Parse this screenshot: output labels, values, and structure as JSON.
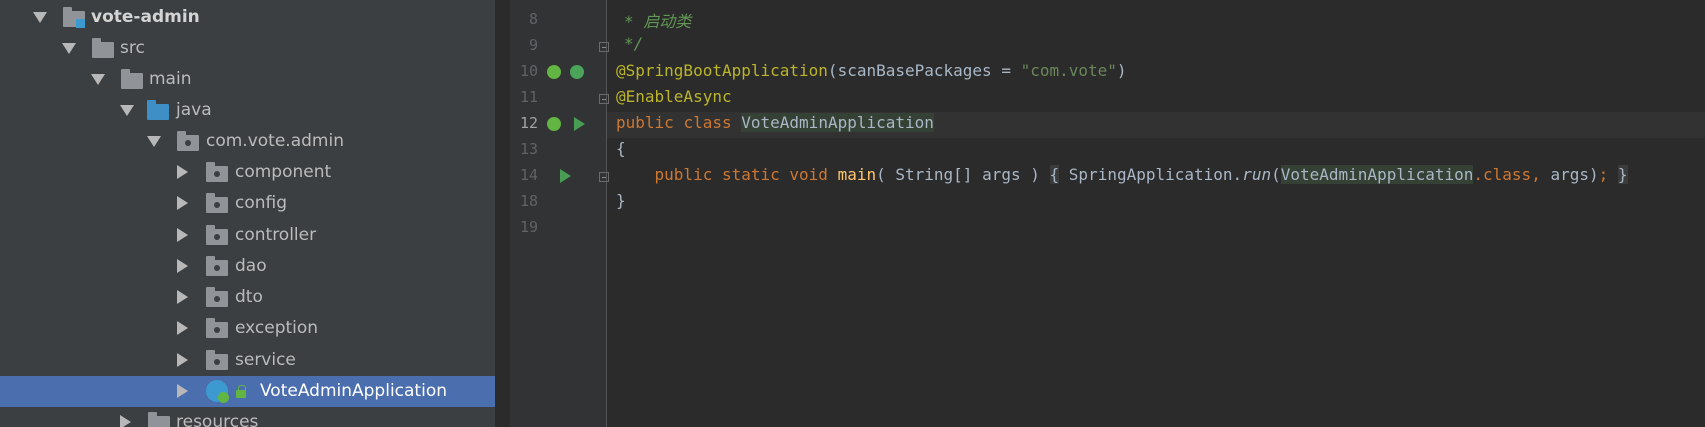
{
  "project_tree": {
    "root": "vote-admin",
    "src": "src",
    "main": "main",
    "java": "java",
    "package": "com.vote.admin",
    "folders": [
      "component",
      "config",
      "controller",
      "dao",
      "dto",
      "exception",
      "service"
    ],
    "selected_class": "VoteAdminApplication",
    "resources": "resources"
  },
  "editor": {
    "line_numbers": [
      "8",
      "9",
      "10",
      "11",
      "12",
      "13",
      "14",
      "18",
      "19"
    ],
    "current_line": "12",
    "line8": "* 启动类",
    "line9": "*/",
    "line10_annotation": "@SpringBootApplication",
    "line10_open": "(",
    "line10_param": "scanBasePackages = ",
    "line10_string": "\"com.vote\"",
    "line10_close": ")",
    "line11_annotation": "@EnableAsync",
    "line12_kw1": "public",
    "line12_kw2": "class",
    "line12_class": "VoteAdminApplication",
    "line13": "{",
    "line14_kw1": "public",
    "line14_kw2": "static",
    "line14_kw3": "void",
    "line14_method": "main",
    "line14_params": "( String[] args )",
    "line14_open_brace": "{",
    "line14_callee": "SpringApplication.",
    "line14_run": "run",
    "line14_arg_class": "VoteAdminApplication",
    "line14_dot_class": ".class,",
    "line14_args": " args)",
    "line14_semicolon": ";",
    "line14_close_brace": "}",
    "line18": "}"
  },
  "colors": {
    "tree_bg": "#3c3f41",
    "selection": "#4b6eaf",
    "editor_bg": "#2b2b2b",
    "keyword": "#cc7832",
    "annotation": "#bbb529",
    "string": "#6a8759",
    "comment": "#629755"
  }
}
